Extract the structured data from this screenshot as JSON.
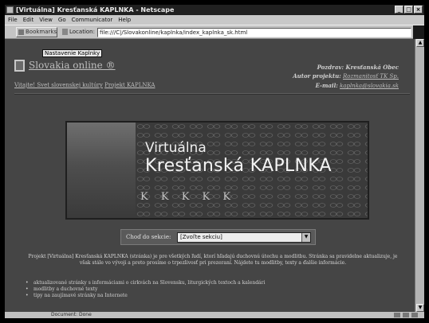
{
  "window": {
    "title": "[Virtuálna] Kresťanská KAPLNKA - Netscape",
    "buttons": [
      "_",
      "□",
      "×"
    ]
  },
  "menu": [
    "File",
    "Edit",
    "View",
    "Go",
    "Communicator",
    "Help"
  ],
  "location_bar": {
    "bookmarks_label": "Bookmarks",
    "location_label": "Location:",
    "url": "file:///C|/Slovakonline/kaplnka/index_kaplnka_sk.html"
  },
  "tooltip": "Nastavenie Kaplnky",
  "page": {
    "site_title": "Slovakia online ®",
    "sub_links": [
      "Vitajte! Svet slovenskej kultúry",
      "Projekt KAPLNKA"
    ],
    "right_info": {
      "greeting": "Pozdrav: Kresťanská Obec",
      "author_label": "Autor projektu:",
      "author_name": "Rozmanitosť TK Sp.",
      "email_label": "E-mail:",
      "email": "kaplnka@slovakia.sk"
    },
    "banner": {
      "line1": "Virtuálna",
      "line2": "Kresťanská KAPLNKA",
      "decoration": "K  K  K  K  K"
    },
    "selector": {
      "label": "Choď do sekcie:",
      "value": "[Zvoľte sekciu]"
    },
    "intro": "Projekt [Virtuálna] Kresťanská KAPLNKA (stránka) je pre všetkých ľudí, ktorí hľadajú duchovnú útechu a modlitbu. Stránka sa pravidelne aktualizuje, je však stále vo vývoji a preto prosíme o trpezlivosť pri prezeraní. Nájdete tu modlitby, texty a ďalšie informácie.",
    "bullets": [
      "aktualizované stránky s informáciami o cirkvách na Slovensku, liturgických textoch a kalendári",
      "modlitby a duchovné texty",
      "tipy na zaujímavé stránky na Internete"
    ]
  },
  "status": {
    "text": "Document: Done"
  }
}
